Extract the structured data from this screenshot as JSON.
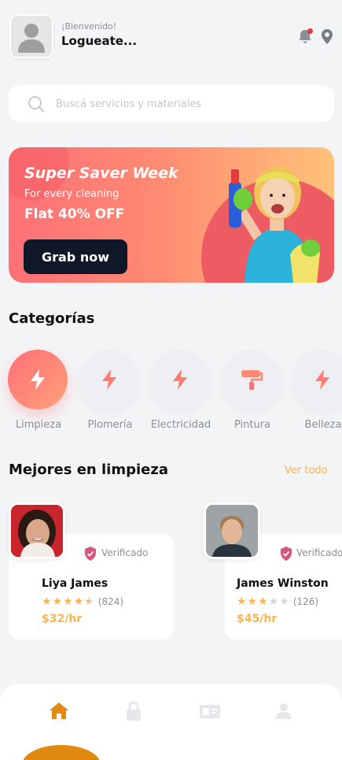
{
  "header": {
    "greeting": "¡Bienvenido!",
    "username": "Logueate...",
    "avatar_icon": "user-placeholder-icon",
    "notification_icon": "bell-icon",
    "location_icon": "location-pin-icon"
  },
  "search": {
    "placeholder": "Buscá servicios y materiales",
    "icon": "search-icon"
  },
  "banner": {
    "title": "Super Saver Week",
    "subtitle": "For every cleaning",
    "offer": "Flat 40% OFF",
    "button_label": "Grab now"
  },
  "categories": {
    "title": "Categorías",
    "items": [
      {
        "label": "Limpieza",
        "icon": "bolt-icon",
        "active": true
      },
      {
        "label": "Plomería",
        "icon": "bolt-icon",
        "active": false
      },
      {
        "label": "Electricidad",
        "icon": "bolt-icon",
        "active": false
      },
      {
        "label": "Pintura",
        "icon": "paint-roller-icon",
        "active": false
      },
      {
        "label": "Belleza",
        "icon": "bolt-icon",
        "active": false
      }
    ]
  },
  "top": {
    "title": "Mejores en limpieza",
    "see_all": "Ver todo",
    "providers": [
      {
        "name": "Liya James",
        "verified_label": "Verificado",
        "rating": 4.5,
        "reviews": "(824)",
        "price": "$32/hr"
      },
      {
        "name": "James Winston",
        "verified_label": "Verificado",
        "rating": 3,
        "reviews": "(126)",
        "price": "$45/hr"
      }
    ]
  },
  "nav": {
    "items": [
      {
        "icon": "home-icon",
        "active": true
      },
      {
        "icon": "lock-icon",
        "active": false
      },
      {
        "icon": "id-card-icon",
        "active": false
      },
      {
        "icon": "profile-icon",
        "active": false
      }
    ]
  },
  "colors": {
    "accent": "#f8b552",
    "brand_red": "#ff7077",
    "nav_active": "#e08a12",
    "verified": "#d4587e",
    "star": "#f8b552"
  }
}
